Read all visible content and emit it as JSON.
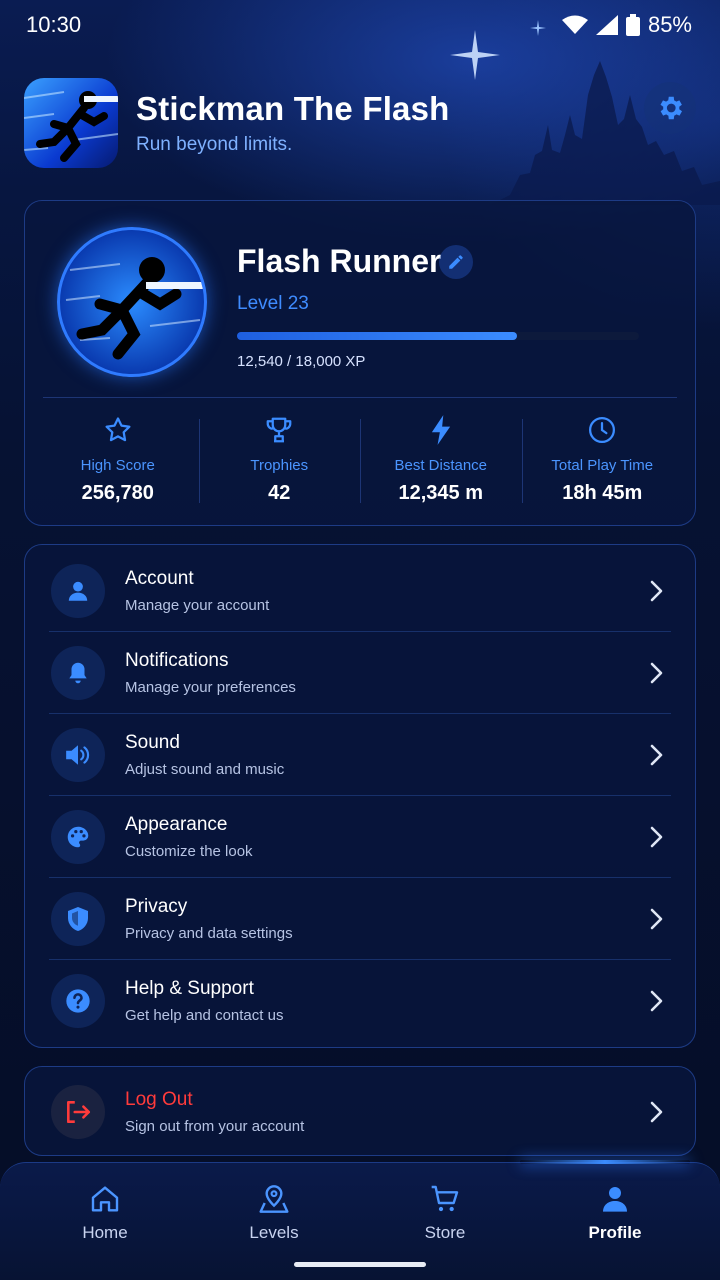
{
  "status_bar": {
    "time": "10:30",
    "battery": "85%"
  },
  "header": {
    "title": "Stickman The Flash",
    "tagline": "Run beyond limits."
  },
  "profile": {
    "name": "Flash Runner",
    "level": "Level 23",
    "xp_text": "12,540 / 18,000 XP",
    "xp_progress": 0.6967
  },
  "stats": [
    {
      "label": "High Score",
      "value": "256,780",
      "icon": "star-icon"
    },
    {
      "label": "Trophies",
      "value": "42",
      "icon": "trophy-icon"
    },
    {
      "label": "Best Distance",
      "value": "12,345 m",
      "icon": "lightning-icon"
    },
    {
      "label": "Total Play Time",
      "value": "18h 45m",
      "icon": "clock-icon"
    }
  ],
  "menu": [
    {
      "title": "Account",
      "subtitle": "Manage your account",
      "icon": "person-icon"
    },
    {
      "title": "Notifications",
      "subtitle": "Manage your preferences",
      "icon": "bell-icon"
    },
    {
      "title": "Sound",
      "subtitle": "Adjust sound and music",
      "icon": "speaker-icon"
    },
    {
      "title": "Appearance",
      "subtitle": "Customize the look",
      "icon": "palette-icon"
    },
    {
      "title": "Privacy",
      "subtitle": "Privacy and data settings",
      "icon": "shield-icon"
    },
    {
      "title": "Help & Support",
      "subtitle": "Get help and contact us",
      "icon": "help-icon"
    }
  ],
  "logout": {
    "title": "Log Out",
    "subtitle": "Sign out from your account"
  },
  "nav": [
    {
      "label": "Home",
      "icon": "home-icon"
    },
    {
      "label": "Levels",
      "icon": "map-pin-icon"
    },
    {
      "label": "Store",
      "icon": "cart-icon"
    },
    {
      "label": "Profile",
      "icon": "person-icon",
      "active": true
    }
  ],
  "colors": {
    "accent": "#3b8cff",
    "danger": "#ff3b3b",
    "background": "#050d24"
  }
}
